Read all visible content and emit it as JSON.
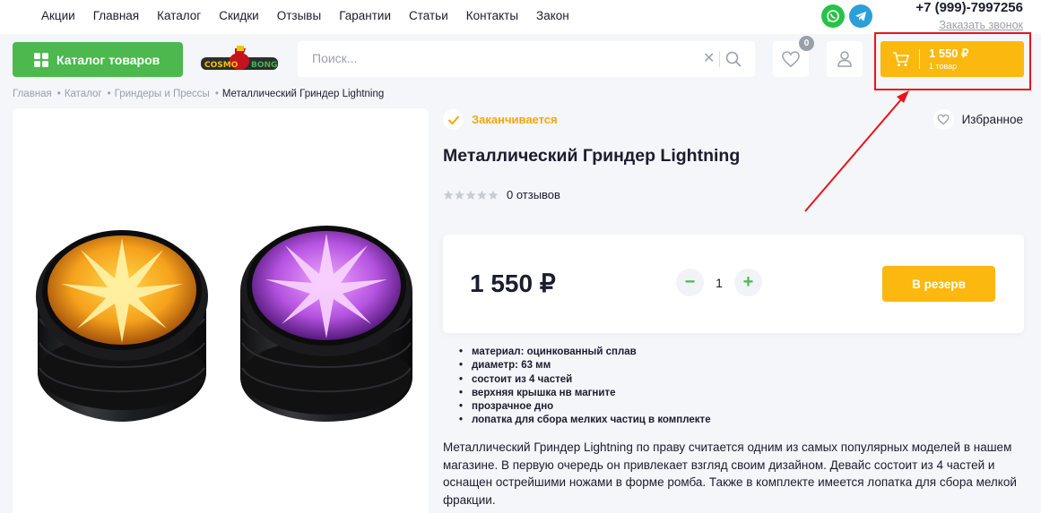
{
  "topnav": {
    "items": [
      "Акции",
      "Главная",
      "Каталог",
      "Скидки",
      "Отзывы",
      "Гарантии",
      "Статьи",
      "Контакты",
      "Закон"
    ],
    "phone": "+7 (999)-7997256",
    "callback": "Заказать звонок"
  },
  "header": {
    "catalog_label": "Каталог товаров",
    "logo_text_left": "COSMO",
    "logo_text_right": "BONG",
    "search_placeholder": "Поиск...",
    "favorites_count": "0",
    "cart_amount": "1 550 ₽",
    "cart_qty": "1 товар"
  },
  "breadcrumb": {
    "items": [
      "Главная",
      "Каталог",
      "Гриндеры и Прессы"
    ],
    "current": "Металлический Гриндер Lightning"
  },
  "product": {
    "stock_status": "Заканчивается",
    "favorite_label": "Избранное",
    "title": "Металлический Гриндер Lightning",
    "reviews": "0 отзывов",
    "rating": 0,
    "price": "1 550 ₽",
    "quantity": "1",
    "reserve_label": "В резерв",
    "features": [
      "материал: оцинкованный сплав",
      "диаметр: 63 мм",
      "состоит из 4 частей",
      "верхняя крышка нв магните",
      "прозрачное дно",
      "лопатка для сбора мелких частиц в комплекте"
    ],
    "description": "Металлический Гриндер Lightning по праву считается одним из самых популярных моделей в нашем магазине. В первую очередь он привлекает взгляд своим дизайном. Девайс состоит из 4 частей и оснащен острейшими ножами в форме ромба. Также в комплекте имеется лопатка для сбора мелкой фракции."
  },
  "colors": {
    "green": "#4cb84e",
    "yellow": "#fbb80e",
    "stock_orange": "#f2a80a",
    "highlight_red": "#e8141c"
  }
}
